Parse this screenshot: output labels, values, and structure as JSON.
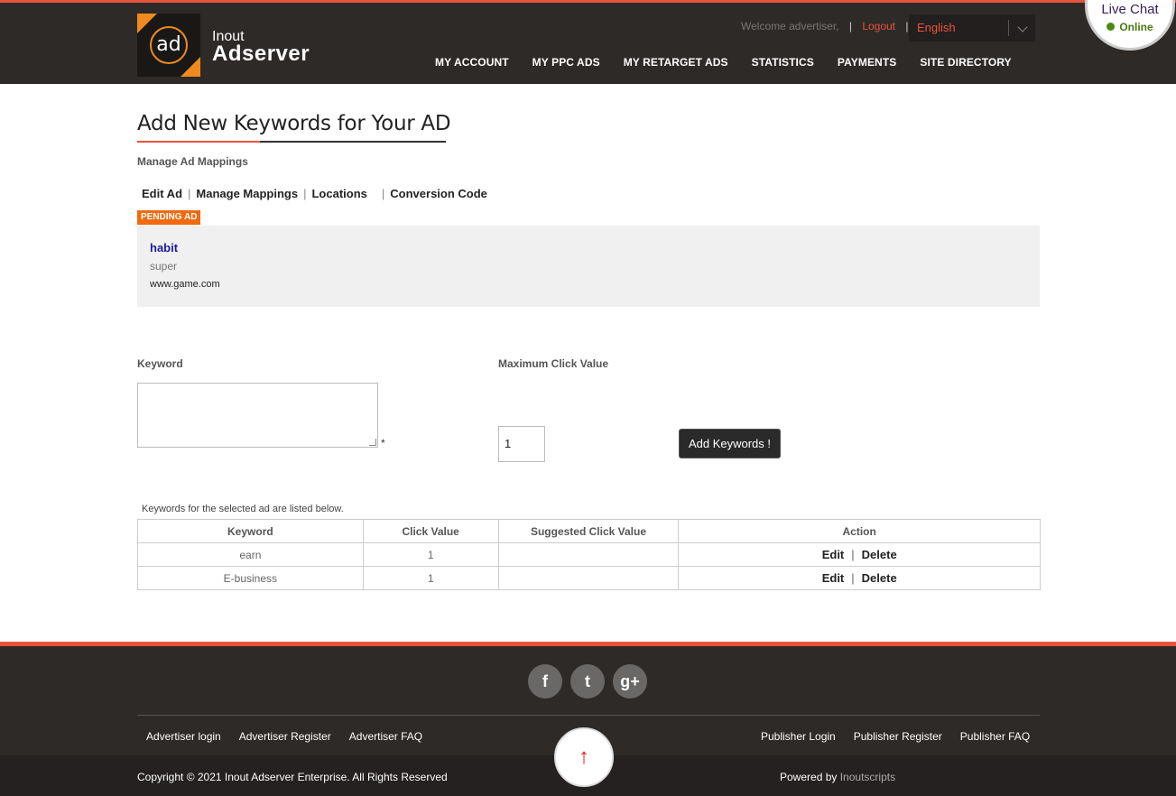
{
  "header": {
    "brand_line1": "Inout",
    "brand_line2": "Adserver",
    "logo_text": "ad",
    "welcome": "Welcome advertiser,",
    "logout": "Logout",
    "language": "English",
    "nav": [
      "MY ACCOUNT",
      "MY PPC ADS",
      "MY RETARGET ADS",
      "STATISTICS",
      "PAYMENTS",
      "SITE DIRECTORY"
    ]
  },
  "livechat": {
    "title": "Live Chat",
    "status": "Online"
  },
  "main": {
    "title": "Add New Keywords for Your AD",
    "subtitle": "Manage Ad Mappings",
    "tabs": [
      "Edit Ad",
      "Manage Mappings",
      "Locations",
      "Conversion Code"
    ],
    "badge": "PENDING AD",
    "ad": {
      "title": "habit",
      "description": "super",
      "url": "www.game.com"
    },
    "form": {
      "keyword_label": "Keyword",
      "keyword_value": "",
      "required_mark": "*",
      "max_click_label": "Maximum Click Value",
      "max_click_value": "1",
      "submit_label": "Add Keywords !"
    },
    "list_note": "Keywords for the selected ad are listed below.",
    "table": {
      "headers": [
        "Keyword",
        "Click Value",
        "Suggested Click Value",
        "Action"
      ],
      "rows": [
        {
          "keyword": "earn",
          "click_value": "1",
          "suggested": "",
          "edit": "Edit",
          "delete": "Delete"
        },
        {
          "keyword": "E-business",
          "click_value": "1",
          "suggested": "",
          "edit": "Edit",
          "delete": "Delete"
        }
      ]
    }
  },
  "footer": {
    "social": [
      "facebook-icon",
      "twitter-icon",
      "google-plus-icon"
    ],
    "social_glyphs": [
      "f",
      "t",
      "g+"
    ],
    "advertiser_links": [
      "Advertiser login",
      "Advertiser Register",
      "Advertiser FAQ"
    ],
    "publisher_links": [
      "Publisher Login",
      "Publisher Register",
      "Publisher FAQ"
    ],
    "copyright": "Copyright © 2021 Inout Adserver Enterprise. All Rights Reserved",
    "powered_prefix": "Powered by",
    "powered_brand": "Inoutscripts",
    "to_top": "↑"
  },
  "colors": {
    "accent": "#e8543a",
    "header_bg": "#2e2a28",
    "badge": "#f06a10",
    "link_blue": "#1a1aa0"
  }
}
